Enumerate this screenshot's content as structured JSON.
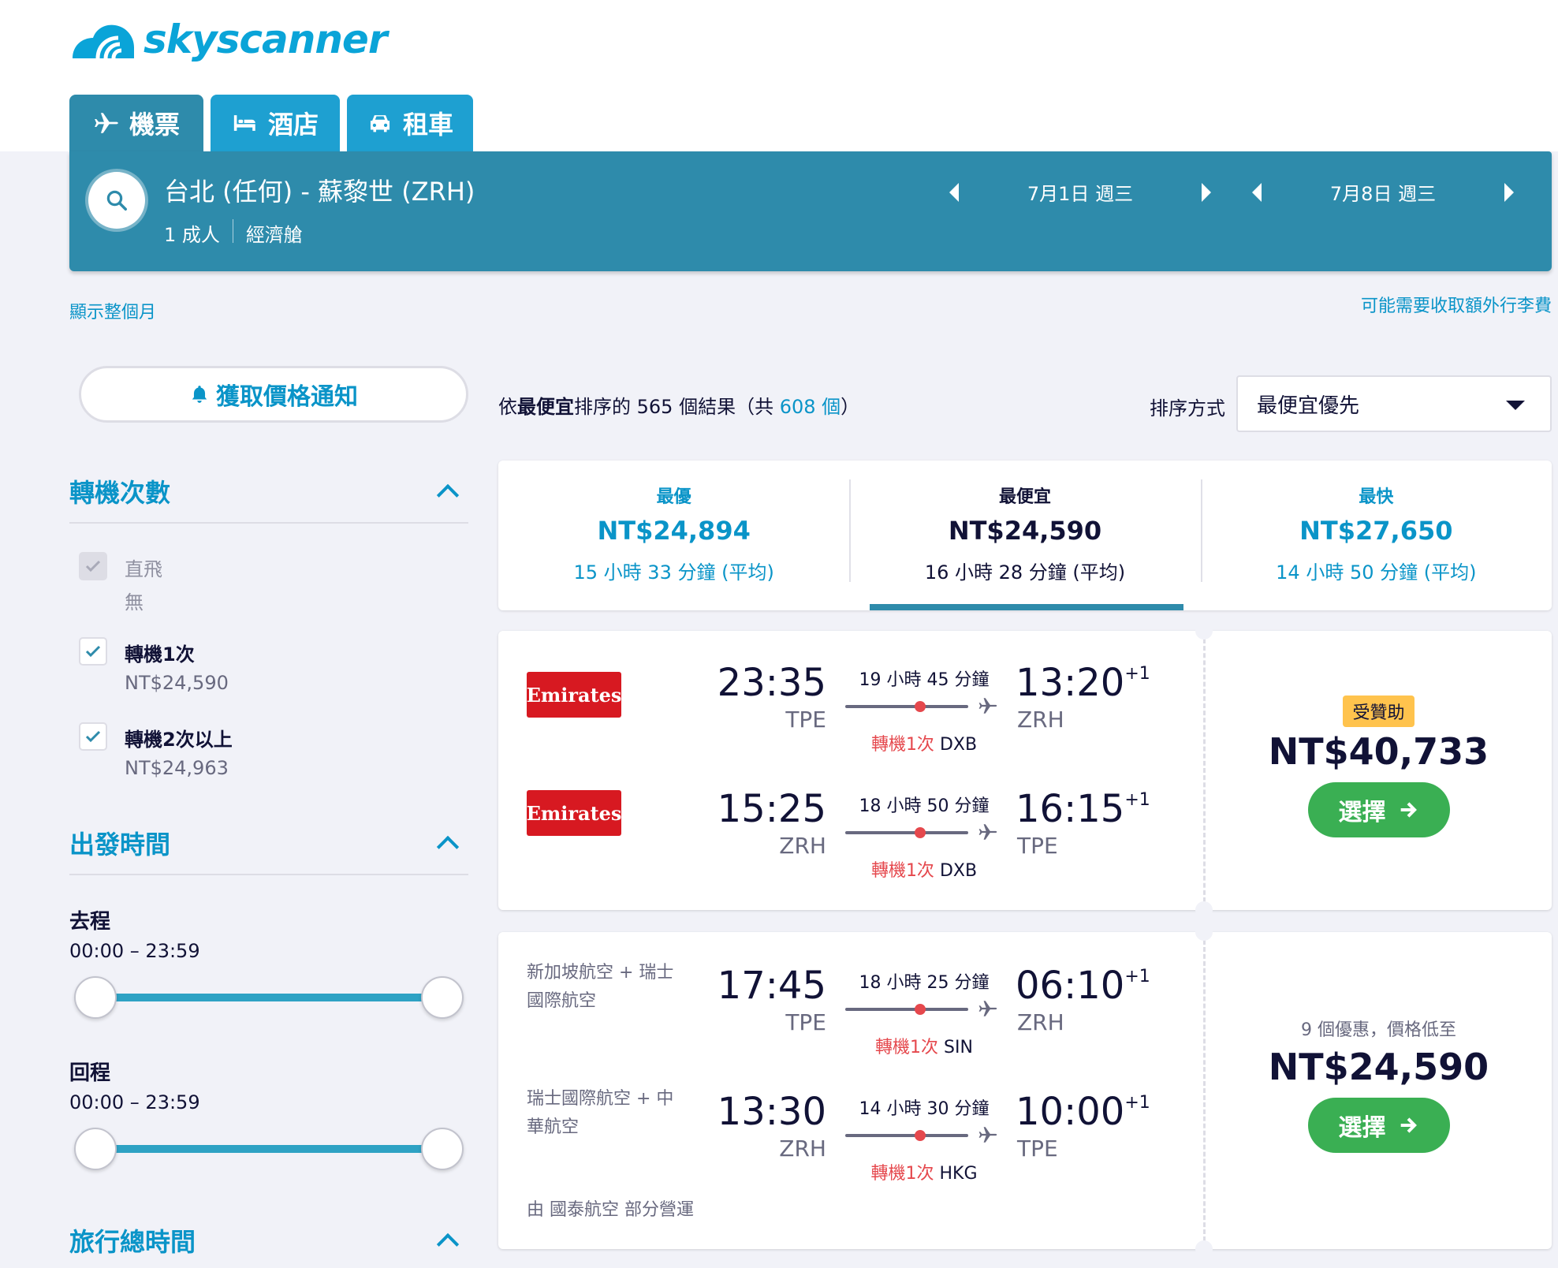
{
  "brand": {
    "name": "skyscanner"
  },
  "tabs": [
    {
      "label": "機票",
      "icon": "plane-icon"
    },
    {
      "label": "酒店",
      "icon": "bed-icon"
    },
    {
      "label": "租車",
      "icon": "car-icon"
    }
  ],
  "search": {
    "route": "台北 (任何) - 蘇黎世 (ZRH)",
    "passengers": "1 成人",
    "cabin": "經濟艙",
    "depart_date": "7月1日 週三",
    "return_date": "7月8日 週三"
  },
  "links": {
    "show_month": "顯示整個月",
    "baggage_fee": "可能需要收取額外行李費"
  },
  "price_alert": {
    "label": "獲取價格通知"
  },
  "filters": {
    "stops": {
      "title": "轉機次數",
      "options": [
        {
          "label": "直飛",
          "value": "無",
          "checked": true,
          "disabled": true
        },
        {
          "label": "轉機1次",
          "value": "NT$24,590",
          "checked": true,
          "disabled": false
        },
        {
          "label": "轉機2次以上",
          "value": "NT$24,963",
          "checked": true,
          "disabled": false
        }
      ]
    },
    "departure_times": {
      "title": "出發時間",
      "outbound": {
        "label": "去程",
        "range": "00:00 – 23:59"
      },
      "return": {
        "label": "回程",
        "range": "00:00 – 23:59"
      }
    },
    "journey_duration": {
      "title": "旅行總時間"
    }
  },
  "results": {
    "prefix": "依",
    "sort_word": "最便宜",
    "middle": "排序的 565 個結果（共 ",
    "total": "608 個",
    "suffix": "）"
  },
  "sort": {
    "label": "排序方式",
    "selected": "最便宜優先"
  },
  "sort_tabs": [
    {
      "title": "最優",
      "price": "NT$24,894",
      "duration": "15 小時 33 分鐘 (平均)",
      "active": false
    },
    {
      "title": "最便宜",
      "price": "NT$24,590",
      "duration": "16 小時 28 分鐘 (平均)",
      "active": true
    },
    {
      "title": "最快",
      "price": "NT$27,650",
      "duration": "14 小時 50 分鐘 (平均)",
      "active": false
    }
  ],
  "cards": [
    {
      "legs": [
        {
          "airline": "Emirates",
          "logo": true,
          "dep_time": "23:35",
          "dep_code": "TPE",
          "duration": "19 小時 45 分鐘",
          "stops_label": "轉機1次",
          "stop_city": "DXB",
          "arr_time": "13:20",
          "day_offset": "+1",
          "arr_code": "ZRH"
        },
        {
          "airline": "Emirates",
          "logo": true,
          "dep_time": "15:25",
          "dep_code": "ZRH",
          "duration": "18 小時 50 分鐘",
          "stops_label": "轉機1次",
          "stop_city": "DXB",
          "arr_time": "16:15",
          "day_offset": "+1",
          "arr_code": "TPE"
        }
      ],
      "badge": "受贊助",
      "price": "NT$40,733",
      "select_label": "選擇"
    },
    {
      "legs": [
        {
          "airline": "新加坡航空 + 瑞士國際航空",
          "logo": false,
          "dep_time": "17:45",
          "dep_code": "TPE",
          "duration": "18 小時 25 分鐘",
          "stops_label": "轉機1次",
          "stop_city": "SIN",
          "arr_time": "06:10",
          "day_offset": "+1",
          "arr_code": "ZRH"
        },
        {
          "airline": "瑞士國際航空 + 中華航空",
          "logo": false,
          "dep_time": "13:30",
          "dep_code": "ZRH",
          "duration": "14 小時 30 分鐘",
          "stops_label": "轉機1次",
          "stop_city": "HKG",
          "arr_time": "10:00",
          "day_offset": "+1",
          "arr_code": "TPE"
        }
      ],
      "deals": "9 個優惠，價格低至",
      "price": "NT$24,590",
      "select_label": "選擇",
      "operated_by": "由 國泰航空 部分營運"
    }
  ]
}
